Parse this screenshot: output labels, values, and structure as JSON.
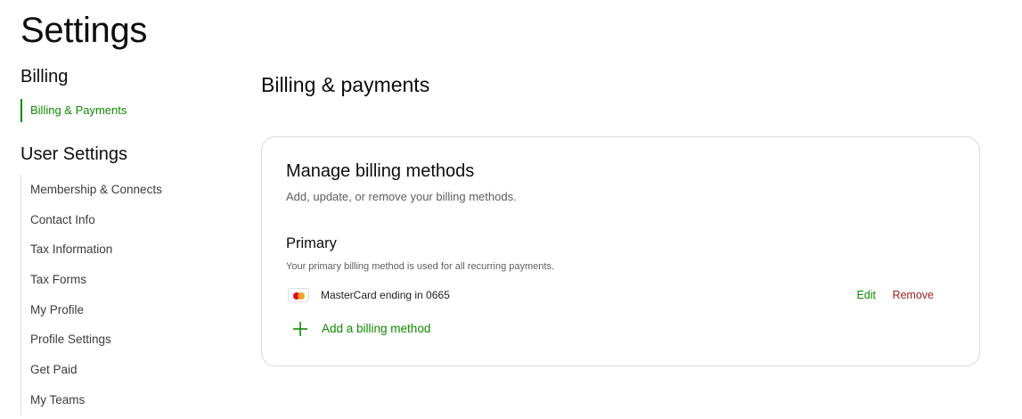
{
  "page": {
    "title": "Settings"
  },
  "sidebar": {
    "billing_heading": "Billing",
    "billing_items": [
      {
        "label": "Billing & Payments",
        "active": true
      }
    ],
    "user_heading": "User Settings",
    "user_items": [
      {
        "label": "Membership & Connects"
      },
      {
        "label": "Contact Info"
      },
      {
        "label": "Tax Information"
      },
      {
        "label": "Tax Forms"
      },
      {
        "label": "My Profile"
      },
      {
        "label": "Profile Settings"
      },
      {
        "label": "Get Paid"
      },
      {
        "label": "My Teams"
      }
    ]
  },
  "main": {
    "title": "Billing & payments",
    "card": {
      "title": "Manage billing methods",
      "subtitle": "Add, update, or remove your billing methods.",
      "primary_heading": "Primary",
      "primary_desc": "Your primary billing method is used for all recurring payments.",
      "method": {
        "icon": "mastercard-icon",
        "label": "MasterCard ending in 0665",
        "edit_label": "Edit",
        "remove_label": "Remove"
      },
      "add_label": "Add a billing method"
    }
  },
  "colors": {
    "accent": "#108a00",
    "remove": "#9e1e1e",
    "border": "#d9d9d9"
  }
}
